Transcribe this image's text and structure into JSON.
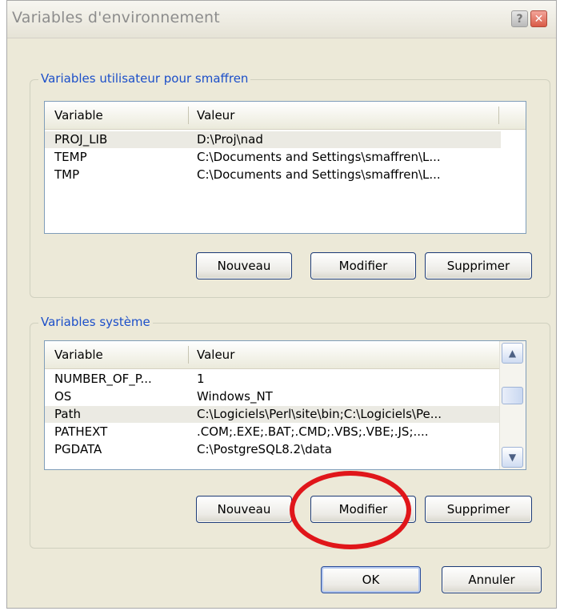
{
  "window": {
    "title": "Variables d'environnement",
    "help_glyph": "?",
    "close_glyph": "✕"
  },
  "user_vars": {
    "label": "Variables utilisateur pour smaffren",
    "columns": [
      "Variable",
      "Valeur"
    ],
    "rows": [
      {
        "name": "PROJ_LIB",
        "value": "D:\\Proj\\nad"
      },
      {
        "name": "TEMP",
        "value": "C:\\Documents and Settings\\smaffren\\L..."
      },
      {
        "name": "TMP",
        "value": "C:\\Documents and Settings\\smaffren\\L..."
      }
    ],
    "buttons": {
      "new": "Nouveau",
      "edit": "Modifier",
      "delete": "Supprimer"
    }
  },
  "system_vars": {
    "label": "Variables système",
    "columns": [
      "Variable",
      "Valeur"
    ],
    "rows": [
      {
        "name": "NUMBER_OF_P...",
        "value": "1"
      },
      {
        "name": "OS",
        "value": "Windows_NT"
      },
      {
        "name": "Path",
        "value": "C:\\Logiciels\\Perl\\site\\bin;C:\\Logiciels\\Pe..."
      },
      {
        "name": "PATHEXT",
        "value": ".COM;.EXE;.BAT;.CMD;.VBS;.VBE;.JS;...."
      },
      {
        "name": "PGDATA",
        "value": "C:\\PostgreSQL8.2\\data"
      }
    ],
    "scroll_up_glyph": "▲",
    "scroll_down_glyph": "▼",
    "buttons": {
      "new": "Nouveau",
      "edit": "Modifier",
      "delete": "Supprimer"
    }
  },
  "footer": {
    "ok": "OK",
    "cancel": "Annuler"
  },
  "colors": {
    "highlight_circle": "#e0161a",
    "group_label": "#1c4fc9"
  }
}
